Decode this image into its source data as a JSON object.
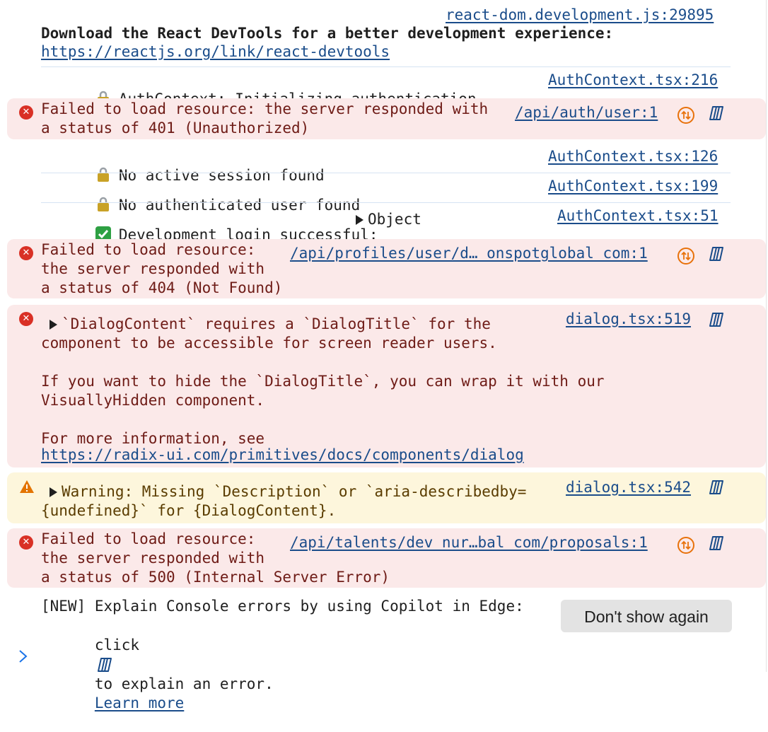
{
  "colors": {
    "error_bg": "#fbe9e9",
    "warning_bg": "#fdf6dc",
    "error_icon": "#d93025",
    "warning_icon": "#e37400",
    "link": "#1a4c8a",
    "copilot_icon": "#1a4c8a",
    "network_icon": "#e8710a"
  },
  "console": {
    "entries": [
      {
        "level": "info",
        "source": "react-dom.development.js:29895",
        "line1": "Download the React DevTools for a better development experience:",
        "link": "https://reactjs.org/link/react-devtools"
      },
      {
        "level": "log",
        "icon": "lock-icon",
        "text": "AuthContext: Initializing authentication...",
        "source": "AuthContext.tsx:216"
      },
      {
        "level": "error",
        "line1": "Failed to load resource: the server responded with",
        "line2": "a status of 401 (Unauthorized)",
        "source": "/api/auth/user:1"
      },
      {
        "level": "log",
        "icon": "lock-icon",
        "text": "No active session found",
        "source": "AuthContext.tsx:126"
      },
      {
        "level": "log",
        "icon": "lock-icon",
        "text": "No authenticated user found",
        "source": "AuthContext.tsx:199"
      },
      {
        "level": "log",
        "icon": "check-icon",
        "text": "Development login successful:",
        "object_label": "Object",
        "source": "AuthContext.tsx:51"
      },
      {
        "level": "error",
        "line1": "Failed to load resource:",
        "line2": "the server responded with",
        "line3": "a status of 404 (Not Found)",
        "source": "/api/profiles/user/d… onspotglobal com:1"
      },
      {
        "level": "error",
        "line1": "`DialogContent` requires a `DialogTitle` for the",
        "line2": "component to be accessible for screen reader users.",
        "line3": "If you want to hide the `DialogTitle`, you can wrap it with our",
        "line4": "VisuallyHidden component.",
        "line5": "For more information, see",
        "link": "https://radix-ui.com/primitives/docs/components/dialog",
        "source": "dialog.tsx:519"
      },
      {
        "level": "warning",
        "line1": "Warning: Missing `Description` or `aria-describedby=",
        "line2": "{undefined}` for {DialogContent}.",
        "source": "dialog.tsx:542"
      },
      {
        "level": "error",
        "line1": "Failed to load resource:",
        "line2": "the server responded with",
        "line3": "a status of 500 (Internal Server Error)",
        "source": "/api/talents/dev nur…bal com/proposals:1"
      }
    ]
  },
  "banner": {
    "line1": "[NEW] Explain Console errors by using Copilot in Edge:",
    "line2_prefix": "click",
    "line2_suffix": "to explain an error.",
    "learn_more": "Learn more",
    "dismiss_label": "Don't show again"
  },
  "prompt_symbol": "›"
}
